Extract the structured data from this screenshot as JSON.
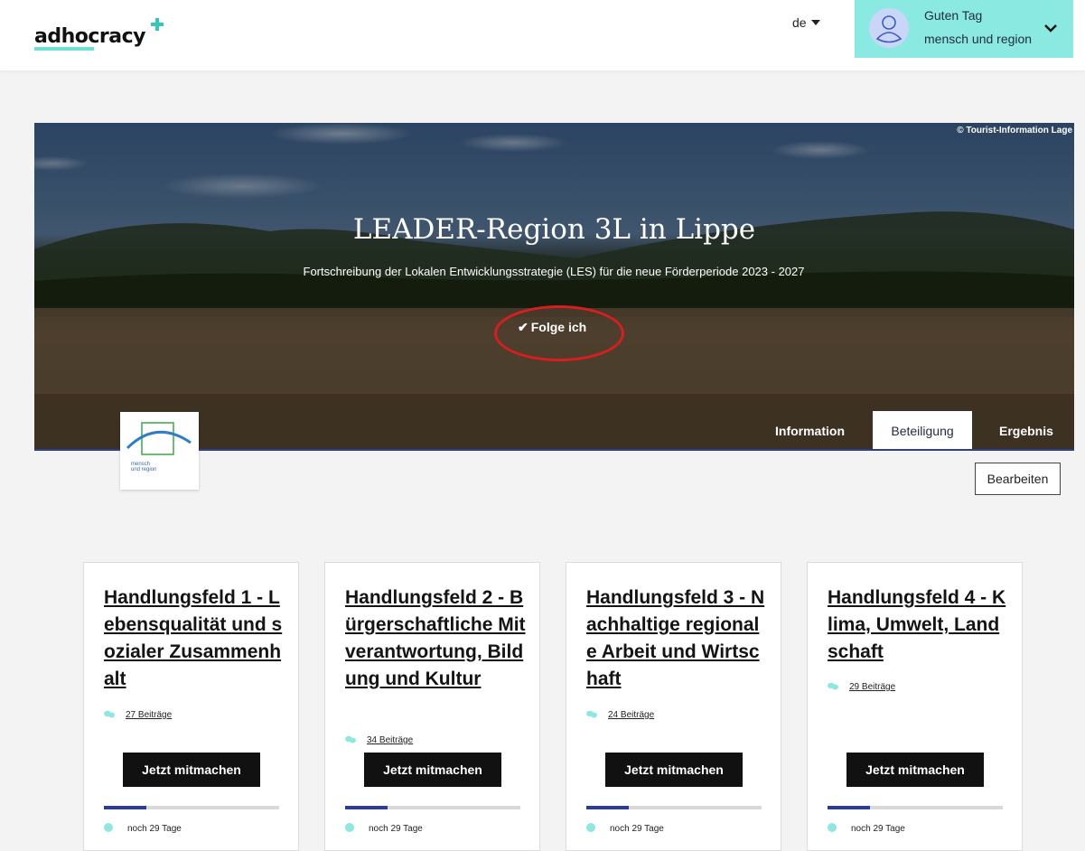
{
  "header": {
    "logo_text": "adhocracy",
    "language": "de",
    "greeting_line1": "Guten Tag",
    "greeting_line2": "mensch und region",
    "accent_color": "#8aeae1"
  },
  "hero": {
    "credit": "© Tourist-Information Lage",
    "title": "LEADER-Region 3L in Lippe",
    "subtitle": "Fortschreibung der Lokalen Entwicklungsstrategie (LES) für die neue Förderperiode 2023 - 2027",
    "follow_label": "Folge ich",
    "tabs": [
      "Information",
      "Beteiligung",
      "Ergebnis"
    ],
    "active_tab": "Beteiligung"
  },
  "organisation": {
    "logo_text_line1": "mensch",
    "logo_text_line2": "und region"
  },
  "edit_label": "Bearbeiten",
  "cards": [
    {
      "title": "Handlungsfeld 1 - Lebensqualität und sozialer Zusammenhalt",
      "count": "27 Beiträge",
      "button": "Jetzt mitmachen",
      "progress": 0.24,
      "remaining": "noch 29 Tage"
    },
    {
      "title": "Handlungsfeld 2 - Bürgerschaftliche Mitverantwortung, Bildung und Kultur",
      "count": "34 Beiträge",
      "button": "Jetzt mitmachen",
      "progress": 0.24,
      "remaining": "noch 29 Tage"
    },
    {
      "title": "Handlungsfeld 3 - Nachhaltige regionale Arbeit und Wirtschaft",
      "count": "24 Beiträge",
      "button": "Jetzt mitmachen",
      "progress": 0.24,
      "remaining": "noch 29 Tage"
    },
    {
      "title": "Handlungsfeld 4 - Klima, Umwelt, Landschaft",
      "count": "29 Beiträge",
      "button": "Jetzt mitmachen",
      "progress": 0.24,
      "remaining": "noch 29 Tage"
    }
  ],
  "icons": {
    "comment": "speech-bubbles-icon",
    "clock": "clock-icon",
    "check": "check-icon",
    "avatar": "user-avatar-icon"
  }
}
